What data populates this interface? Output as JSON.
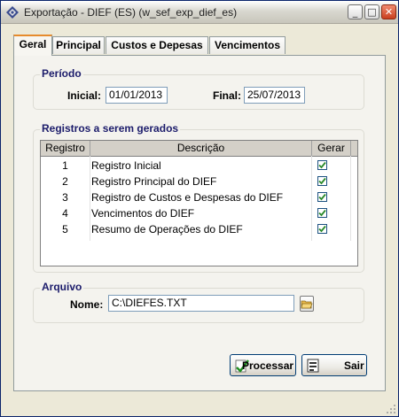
{
  "window": {
    "title": "Exportação - DIEF (ES) (w_sef_exp_dief_es)",
    "minimize_glyph": "_",
    "maximize_glyph": "□",
    "close_glyph": "✕"
  },
  "tabs": [
    {
      "label": "Geral",
      "active": true
    },
    {
      "label": "Principal",
      "active": false
    },
    {
      "label": "Custos e Depesas",
      "active": false
    },
    {
      "label": "Vencimentos",
      "active": false
    }
  ],
  "periodo": {
    "title": "Período",
    "inicial_label": "Inicial:",
    "inicial_value": "01/01/2013",
    "final_label": "Final:",
    "final_value": "25/07/2013"
  },
  "registros": {
    "title": "Registros a serem gerados",
    "columns": [
      "Registro",
      "Descrição",
      "Gerar"
    ],
    "rows": [
      {
        "num": "1",
        "desc": "Registro Inicial",
        "gerar": true
      },
      {
        "num": "2",
        "desc": "Registro Principal do DIEF",
        "gerar": true
      },
      {
        "num": "3",
        "desc": "Registro de Custos e Despesas do DIEF",
        "gerar": true
      },
      {
        "num": "4",
        "desc": "Vencimentos do DIEF",
        "gerar": true
      },
      {
        "num": "5",
        "desc": "Resumo de Operações do DIEF",
        "gerar": true
      }
    ]
  },
  "arquivo": {
    "title": "Arquivo",
    "nome_label": "Nome:",
    "nome_value": "C:\\DIEFES.TXT"
  },
  "buttons": {
    "processar": "Processar",
    "sair": "Sair"
  },
  "colors": {
    "title_text": "#1c1c6b",
    "check": "#2a8a2a",
    "tab_highlight": "#e68b2c"
  }
}
